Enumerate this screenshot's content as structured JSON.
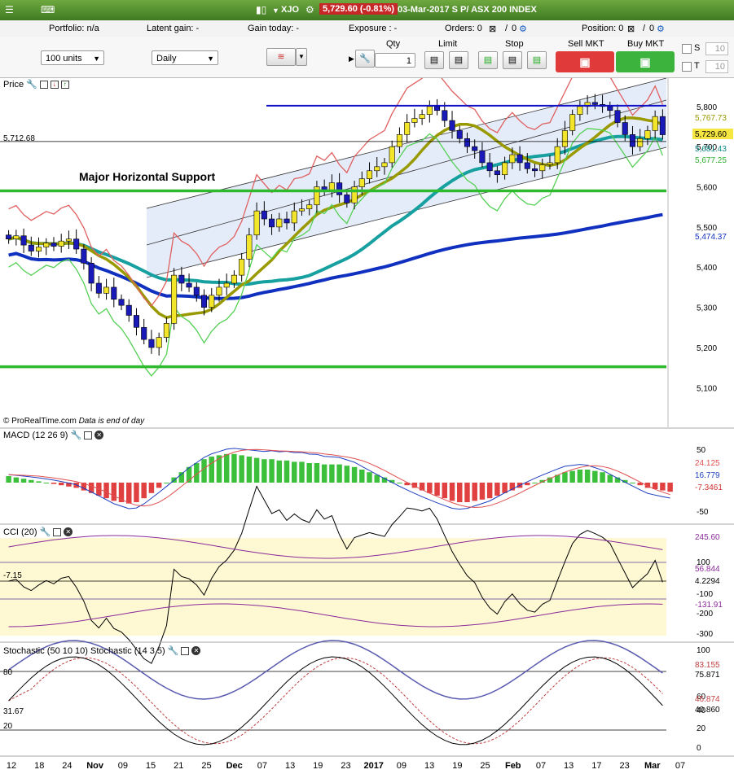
{
  "window": {
    "symbol": "XJO",
    "price_badge": "5,729.60 (-0.81%)",
    "date_title": "03-Mar-2017 S P/ ASX 200 INDEX"
  },
  "status": {
    "portfolio": "Portfolio: n/a",
    "latent": "Latent gain: -",
    "gain_today": "Gain today: -",
    "exposure": "Exposure : -",
    "orders": "Orders: 0",
    "position": "Position: 0",
    "zero": "0"
  },
  "toolbar": {
    "units": "100 units",
    "period": "Daily",
    "qty_label": "Qty",
    "qty_value": "1",
    "limit_label": "Limit",
    "stop_label": "Stop",
    "sell_label": "Sell MKT",
    "buy_label": "Buy MKT",
    "s_label": "S",
    "t_label": "T",
    "s_value": "10",
    "t_value": "10"
  },
  "price_panel": {
    "title": "Price",
    "annotation": "Major Horizontal Support",
    "credit": "© ProRealTime.com",
    "credit_note": "Data is end of day",
    "left_label": "5,712.68",
    "y_ticks": [
      "5,800",
      "5,700",
      "5,600",
      "5,500",
      "5,400",
      "5,300",
      "5,200",
      "5,100"
    ],
    "badges": [
      {
        "text": "5,767.73",
        "color": "#999900"
      },
      {
        "text": "5,729.60",
        "color": "#000000",
        "bg": "#f5e642"
      },
      {
        "text": "5,681.43",
        "color": "#108a8a"
      },
      {
        "text": "5,677.25",
        "color": "#30b030"
      },
      {
        "text": "5,474.37",
        "color": "#1030c0"
      }
    ]
  },
  "macd_panel": {
    "title": "MACD (12 26 9)",
    "y_ticks": [
      "50",
      "-50"
    ],
    "badges": [
      {
        "text": "24.125",
        "color": "#e05050"
      },
      {
        "text": "16.779",
        "color": "#2040c0"
      },
      {
        "text": "-7.3461",
        "color": "#d03030"
      }
    ]
  },
  "cci_panel": {
    "title": "CCI (20)",
    "left_label": "-7.15",
    "y_ticks": [
      "100",
      "-100",
      "-200",
      "-300"
    ],
    "badges": [
      {
        "text": "245.60",
        "color": "#8a2a9a"
      },
      {
        "text": "56.844",
        "color": "#8a2a9a"
      },
      {
        "text": "4.2294",
        "color": "#000000"
      },
      {
        "text": "-131.91",
        "color": "#8a2a9a"
      }
    ]
  },
  "stoch_panel": {
    "title": "Stochastic (50 10 10) Stochastic (14 3 5)",
    "left_labels": [
      "80",
      "31.67",
      "20"
    ],
    "y_ticks": [
      "100",
      "60",
      "40",
      "20",
      "0"
    ],
    "badges": [
      {
        "text": "83.155",
        "color": "#c04040"
      },
      {
        "text": "75.871",
        "color": "#000000"
      },
      {
        "text": "46.874",
        "color": "#c04040"
      },
      {
        "text": "40.860",
        "color": "#000000"
      }
    ]
  },
  "x_axis": {
    "labels": [
      "12",
      "18",
      "24",
      "Nov",
      "09",
      "15",
      "21",
      "25",
      "Dec",
      "07",
      "13",
      "19",
      "23",
      "2017",
      "09",
      "13",
      "19",
      "25",
      "Feb",
      "07",
      "13",
      "17",
      "23",
      "Mar",
      "07"
    ]
  },
  "chart_data": {
    "type": "candlestick",
    "ylim": [
      5050,
      5830
    ],
    "start_price": 5480,
    "closes": [
      5470,
      5478,
      5455,
      5440,
      5450,
      5460,
      5452,
      5465,
      5470,
      5445,
      5410,
      5360,
      5335,
      5350,
      5320,
      5305,
      5280,
      5250,
      5220,
      5200,
      5225,
      5260,
      5380,
      5360,
      5350,
      5330,
      5300,
      5330,
      5350,
      5360,
      5380,
      5420,
      5480,
      5540,
      5520,
      5500,
      5520,
      5510,
      5540,
      5545,
      5555,
      5600,
      5590,
      5610,
      5580,
      5560,
      5600,
      5620,
      5640,
      5650,
      5660,
      5700,
      5730,
      5760,
      5770,
      5780,
      5800,
      5790,
      5765,
      5740,
      5720,
      5700,
      5690,
      5660,
      5640,
      5630,
      5660,
      5680,
      5660,
      5645,
      5640,
      5655,
      5660,
      5700,
      5740,
      5780,
      5800,
      5810,
      5805,
      5800,
      5790,
      5760,
      5730,
      5700,
      5720,
      5740,
      5775,
      5729.6
    ],
    "levels": {
      "resistance": 5802,
      "support_major": 5590,
      "support_low": 5152,
      "ref_line": 5712.68
    },
    "macd_hist": [
      5,
      4,
      3,
      2,
      1,
      0,
      -1,
      -2,
      -3,
      -4,
      -6,
      -8,
      -10,
      -12,
      -14,
      -15,
      -16,
      -15,
      -12,
      -8,
      -4,
      0,
      4,
      8,
      12,
      15,
      18,
      20,
      21,
      22,
      22,
      21,
      20,
      19,
      18,
      18,
      17,
      17,
      16,
      16,
      15,
      15,
      14,
      14,
      14,
      13,
      12,
      10,
      8,
      6,
      4,
      2,
      0,
      -2,
      -4,
      -6,
      -8,
      -10,
      -12,
      -14,
      -15,
      -15,
      -14,
      -13,
      -12,
      -10,
      -8,
      -6,
      -4,
      -2,
      0,
      2,
      4,
      6,
      8,
      9,
      10,
      10,
      9,
      8,
      6,
      4,
      2,
      0,
      -2,
      -4,
      -5,
      -6,
      -7
    ],
    "series": [
      {
        "name": "MACD (12 26 9)"
      },
      {
        "name": "CCI (20)"
      },
      {
        "name": "Stochastic (50 10 10)"
      },
      {
        "name": "Stochastic (14 3 5)"
      }
    ]
  }
}
